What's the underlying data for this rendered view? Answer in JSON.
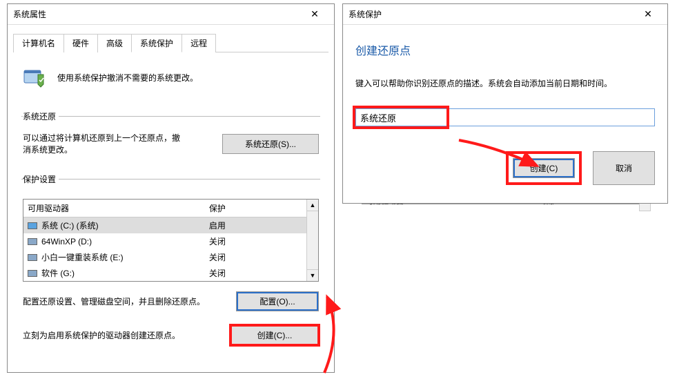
{
  "win1": {
    "title": "系统属性",
    "tabs": {
      "computer_name": "计算机名",
      "hardware": "硬件",
      "advanced": "高级",
      "protection": "系统保护",
      "remote": "远程"
    },
    "intro": "使用系统保护撤消不需要的系统更改。",
    "restore_section": {
      "legend": "系统还原",
      "desc": "可以通过将计算机还原到上一个还原点，撤消系统更改。",
      "button": "系统还原(S)..."
    },
    "protect_section": {
      "legend": "保护设置",
      "col_drive": "可用驱动器",
      "col_prot": "保护",
      "drives": [
        {
          "name": "系统 (C:) (系统)",
          "status": "启用",
          "icon": "sys"
        },
        {
          "name": "64WinXP  (D:)",
          "status": "关闭",
          "icon": "hdd"
        },
        {
          "name": "小白一键重装系统 (E:)",
          "status": "关闭",
          "icon": "hdd"
        },
        {
          "name": "软件 (G:)",
          "status": "关闭",
          "icon": "hdd"
        }
      ],
      "config_desc": "配置还原设置、管理磁盘空间，并且删除还原点。",
      "config_btn": "配置(O)...",
      "create_desc": "立刻为启用系统保护的驱动器创建还原点。",
      "create_btn": "创建(C)..."
    }
  },
  "win2": {
    "title": "系统保护",
    "heading": "创建还原点",
    "desc": "键入可以帮助你识别还原点的描述。系统会自动添加当前日期和时间。",
    "input_value": "系统还原",
    "create": "创建(C)",
    "cancel": "取消"
  },
  "bg": {
    "col1": "可用驱动器",
    "col2": "保护"
  }
}
